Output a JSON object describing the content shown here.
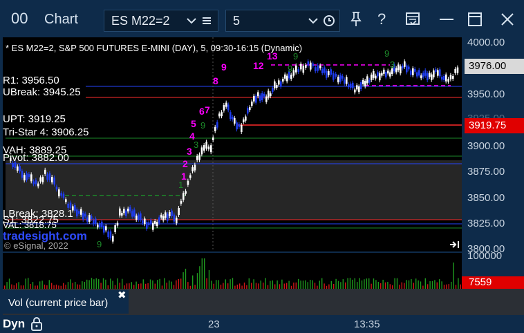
{
  "titlebar": {
    "app_icon": "00",
    "title": "Chart",
    "symbol": "ES M22=2",
    "interval": "5",
    "icons": [
      "chevron-down-icon",
      "menu-icon",
      "clock-icon",
      "pin-icon",
      "help-icon",
      "template-icon",
      "minimize-icon",
      "maximize-icon",
      "close-icon"
    ],
    "help_label": "?"
  },
  "chart": {
    "header": "* ES M22=2, S&P 500 FUTURES E-MINI (DAY), 5, 09:30-16:15 (Dynamic)",
    "watermark": "tradesight.com",
    "copyright": "© eSignal, 2022",
    "levels": {
      "r1": "R1: 3956.50",
      "ubreak": "UBreak: 3945.25",
      "upt": "UPT: 3919.25",
      "tristar": "Tri-Star 4: 3906.25",
      "vah": "VAH: 3889.25",
      "pivot": "Pivot: 3882.00",
      "lbreak": "LBreak: 3828.1",
      "s1": "S1: 3822.75",
      "val": "VAL: 3818.75"
    },
    "counts_magenta": [
      "1",
      "2",
      "3",
      "4",
      "5",
      "6",
      "7",
      "8",
      "9",
      "12",
      "13"
    ],
    "counts_green": [
      "1",
      "3",
      "9",
      "9",
      "9",
      "9",
      "9",
      "3"
    ],
    "colors": {
      "up": "#ffffff",
      "down": "#1f3df0",
      "r1": "#2444ff",
      "red_line": "#ff2b2b",
      "green_line": "#1d8a2a",
      "magenta": "#ff00ff",
      "value_area": "#2a2a2a"
    }
  },
  "price_axis": {
    "labels": [
      "4000.00",
      "3975.00",
      "3950.00",
      "3925.00",
      "3900.00",
      "3875.00",
      "3850.00",
      "3825.00",
      "3800.00"
    ],
    "last_price": "3976.00",
    "upt_marker": "3919.75"
  },
  "volume": {
    "axis_label": "100000",
    "current": "7559",
    "pane_label": "Vol (current price bar)",
    "close_label": "✖"
  },
  "bottom": {
    "mode": "Dyn",
    "time_labels": [
      "23",
      "13:35"
    ]
  }
}
